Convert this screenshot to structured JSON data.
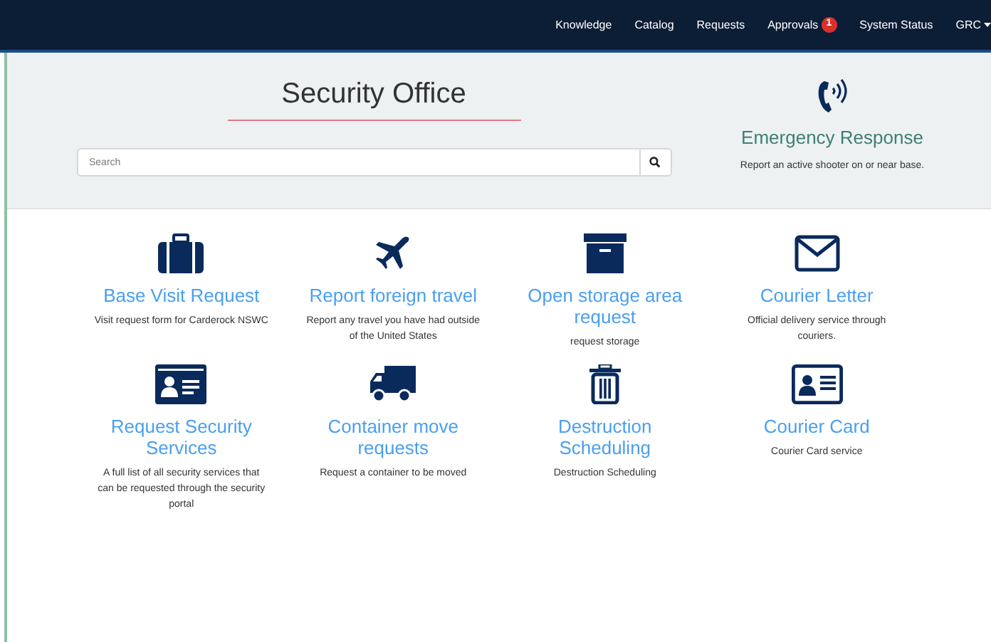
{
  "nav": {
    "items": [
      {
        "label": "Knowledge"
      },
      {
        "label": "Catalog"
      },
      {
        "label": "Requests"
      },
      {
        "label": "Approvals",
        "badge": "1"
      },
      {
        "label": "System Status"
      },
      {
        "label": "GRC",
        "dropdown": true
      }
    ]
  },
  "header": {
    "title": "Security Office",
    "search": {
      "placeholder": "Search"
    }
  },
  "emergency": {
    "title": "Emergency Response",
    "description": "Report an active shooter on or near base."
  },
  "services": [
    {
      "title": "Base Visit Request",
      "description": "Visit request form for Carderock NSWC"
    },
    {
      "title": "Report foreign travel",
      "description": "Report any travel you have had outside of the United States"
    },
    {
      "title": "Open storage area request",
      "description": "request storage"
    },
    {
      "title": "Courier Letter",
      "description": "Official delivery service through couriers."
    },
    {
      "title": "Request Security Services",
      "description": "A full list of all security services that can be requested through the security portal"
    },
    {
      "title": "Container move requests",
      "description": "Request a container to be moved"
    },
    {
      "title": "Destruction Scheduling",
      "description": "Destruction Scheduling"
    },
    {
      "title": "Courier Card",
      "description": "Courier Card service"
    }
  ]
}
